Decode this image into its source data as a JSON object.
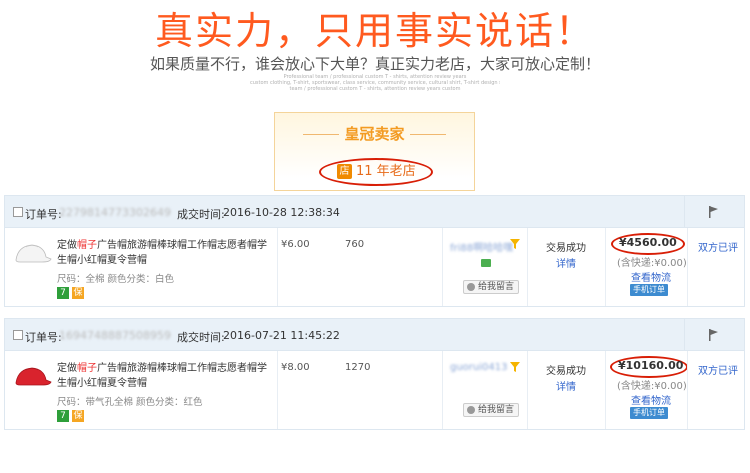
{
  "banner": {
    "title": "真实力，只用事实说话！",
    "subtitle": "如果质量不行，谁会放心下大单？真正实力老店，大家可放心定制！",
    "small_lines": [
      "Professional team / professional custom T - shirts, attention review years",
      "custom clothing, T-shirt, sportswear, class service, community service, cultural shirt, T-shirt design service",
      "team / professional custom T - shirts, attention review years custom"
    ]
  },
  "badge": {
    "title": "皇冠卖家",
    "shop_icon": "店",
    "years": "11 年老店"
  },
  "orders": [
    {
      "order_no_label": "订单号:",
      "order_no": "2279814773302649",
      "time_label": "成交时间:",
      "time": "2016-10-28 12:38:34",
      "product_image": "white-cap",
      "title_pre": "定做",
      "title_hl": "帽子",
      "title_post": "广告帽旅游帽棒球帽工作帽志愿者帽学生帽小红帽夏令营帽",
      "attributes": "尺码：全棉  颜色分类：白色",
      "price": "¥6.00",
      "quantity": "760",
      "buyer": "fri88啊哈哈嘿",
      "leave_message": "给我留言",
      "status": "交易成功",
      "detail": "详情",
      "total": "¥4560.00",
      "shipping": "(含快递:¥0.00)",
      "logistics": "查看物流",
      "mobile_order": "手机订单",
      "rated": "双方已评"
    },
    {
      "order_no_label": "订单号:",
      "order_no": "1694748887508959",
      "time_label": "成交时间:",
      "time": "2016-07-21 11:45:22",
      "product_image": "red-cap",
      "title_pre": "定做",
      "title_hl": "帽子",
      "title_post": "广告帽旅游帽棒球帽工作帽志愿者帽学生帽小红帽夏令营帽",
      "attributes": "尺码：带气孔全棉  颜色分类：红色",
      "price": "¥8.00",
      "quantity": "1270",
      "buyer": "guorui0413",
      "leave_message": "给我留言",
      "status": "交易成功",
      "detail": "详情",
      "total": "¥10160.00",
      "shipping": "(含快递:¥0.00)",
      "logistics": "查看物流",
      "mobile_order": "手机订单",
      "rated": "双方已评"
    }
  ],
  "colors": {
    "accent_orange": "#ff5a1f",
    "highlight_red": "#d81e06",
    "link_blue": "#3366cc",
    "header_bg": "#e9f1f8"
  },
  "icons": [
    "shop-icon",
    "flag-icon",
    "filter-icon",
    "message-icon",
    "tmall-7-icon",
    "guarantee-icon"
  ]
}
